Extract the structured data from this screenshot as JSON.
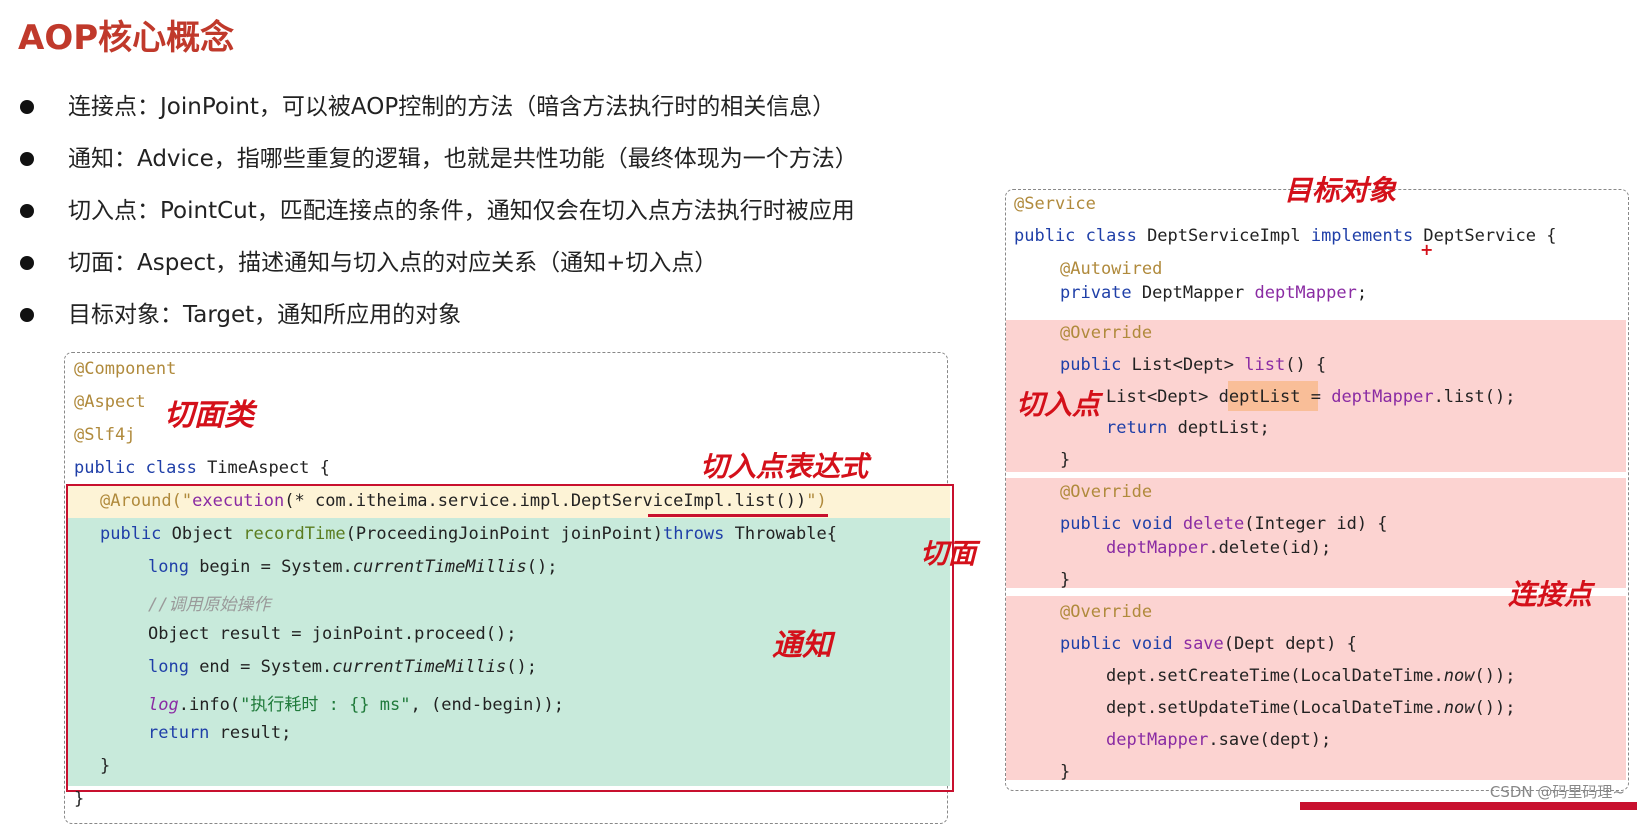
{
  "title": "AOP核心概念",
  "bullets": [
    "连接点：JoinPoint，可以被AOP控制的方法（暗含方法执行时的相关信息）",
    "通知：Advice，指哪些重复的逻辑，也就是共性功能（最终体现为一个方法）",
    "切入点：PointCut，匹配连接点的条件，通知仅会在切入点方法执行时被应用",
    "切面：Aspect，描述通知与切入点的对应关系（通知+切入点）",
    "目标对象：Target，通知所应用的对象"
  ],
  "left_code": {
    "a1": "@Component",
    "a2": "@Aspect",
    "a3": "@Slf4j",
    "l4_kw": "public class",
    "l4_rest": " TimeAspect {",
    "l5_ann": "@Around(\"",
    "l5_exec": "execution",
    "l5_rest": "(* com.itheima.service.impl.DeptServiceImpl.list())",
    "l5_end": "\")",
    "l6_kw": "public",
    "l6_a": " Object ",
    "l6_fn": "recordTime",
    "l6_b": "(ProceedingJoinPoint joinPoint)",
    "l6_kw2": "throws",
    "l6_c": " Throwable{",
    "l7_kw": "long",
    "l7_a": " begin = System.",
    "l7_it": "currentTimeMillis",
    "l7_b": "();",
    "l8": "//调用原始操作",
    "l9": "Object result = joinPoint.proceed();",
    "l10_kw": "long",
    "l10_a": " end = System.",
    "l10_it": "currentTimeMillis",
    "l10_b": "();",
    "l11_it": "log",
    "l11_a": ".info(",
    "l11_str": "\"执行耗时 : {} ms\"",
    "l11_b": ", (end-begin));",
    "l12_kw": "return",
    "l12_a": " result;",
    "l13": "}",
    "l14": "}"
  },
  "right_code": {
    "r1": "@Service",
    "r2_kw": "public class",
    "r2_a": " DeptServiceImpl ",
    "r2_kw2": "implements",
    "r2_b": " DeptService {",
    "r3": "@Autowired",
    "r4_kw": "private",
    "r4_a": " DeptMapper ",
    "r4_fld": "deptMapper",
    "r4_b": ";",
    "r5": "@Override",
    "r6_kw": "public",
    "r6_a": " List<Dept> ",
    "r6_fn": "list",
    "r6_b": "() {",
    "r7_a": "List<Dept> ",
    "r7_hl": "deptList",
    "r7_b": " = ",
    "r7_fld": "deptMapper",
    "r7_c": ".list();",
    "r8_kw": "return",
    "r8_a": " deptList;",
    "r9": "}",
    "r10": "@Override",
    "r11_kw": "public void",
    "r11_fn": " delete",
    "r11_a": "(Integer id) {",
    "r12_fld": "deptMapper",
    "r12_a": ".delete(id);",
    "r13": "}",
    "r14": "@Override",
    "r15_kw": "public void",
    "r15_fn": " save",
    "r15_a": "(Dept dept) {",
    "r16_a": "dept.setCreateTime(LocalDateTime.",
    "r16_it": "now",
    "r16_b": "());",
    "r17_a": "dept.setUpdateTime(LocalDateTime.",
    "r17_it": "now",
    "r17_b": "());",
    "r18_fld": "deptMapper",
    "r18_a": ".save(dept);",
    "r19": "}"
  },
  "handwritten": {
    "aspect_class": "切面类",
    "pointcut_expr": "切入点表达式",
    "aspect": "切面",
    "advice": "通知",
    "target": "目标对象",
    "pointcut": "切入点",
    "joinpoint": "连接点"
  },
  "watermark": "CSDN @码里码理~"
}
